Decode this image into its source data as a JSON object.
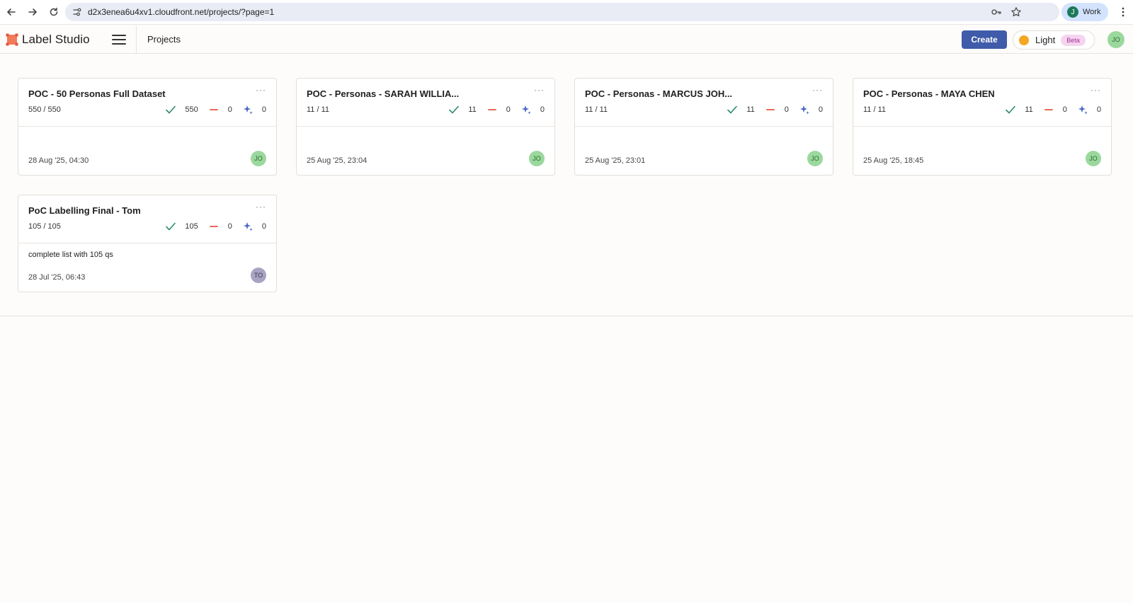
{
  "browser": {
    "url": "d2x3enea6u4xv1.cloudfront.net/projects/?page=1",
    "profile_initial": "J",
    "profile_label": "Work"
  },
  "app": {
    "name": "Label Studio",
    "breadcrumb": "Projects",
    "create_label": "Create",
    "theme_label": "Light",
    "beta_label": "Beta",
    "user_initials": "JO",
    "accent_color": "#3f5ba9"
  },
  "projects": [
    {
      "title": "POC - 50 Personas Full Dataset",
      "progress": "550 / 550",
      "completed": "550",
      "skipped": "0",
      "predictions": "0",
      "description": "",
      "date": "28 Aug '25, 04:30",
      "owner": "JO"
    },
    {
      "title": "POC - Personas - SARAH WILLIA...",
      "progress": "11 / 11",
      "completed": "11",
      "skipped": "0",
      "predictions": "0",
      "description": "",
      "date": "25 Aug '25, 23:04",
      "owner": "JO"
    },
    {
      "title": "POC - Personas - MARCUS JOH...",
      "progress": "11 / 11",
      "completed": "11",
      "skipped": "0",
      "predictions": "0",
      "description": "",
      "date": "25 Aug '25, 23:01",
      "owner": "JO"
    },
    {
      "title": "POC - Personas - MAYA CHEN",
      "progress": "11 / 11",
      "completed": "11",
      "skipped": "0",
      "predictions": "0",
      "description": "",
      "date": "25 Aug '25, 18:45",
      "owner": "JO"
    },
    {
      "title": "PoC Labelling Final - Tom",
      "progress": "105 / 105",
      "completed": "105",
      "skipped": "0",
      "predictions": "0",
      "description": "complete list with 105 qs",
      "date": "28 Jul '25, 06:43",
      "owner": "TO"
    }
  ],
  "colors": {
    "completed": "#2a8b6b",
    "skipped": "#e4543e",
    "predictions": "#4a67c8",
    "theme_dot": "#f5a623"
  }
}
